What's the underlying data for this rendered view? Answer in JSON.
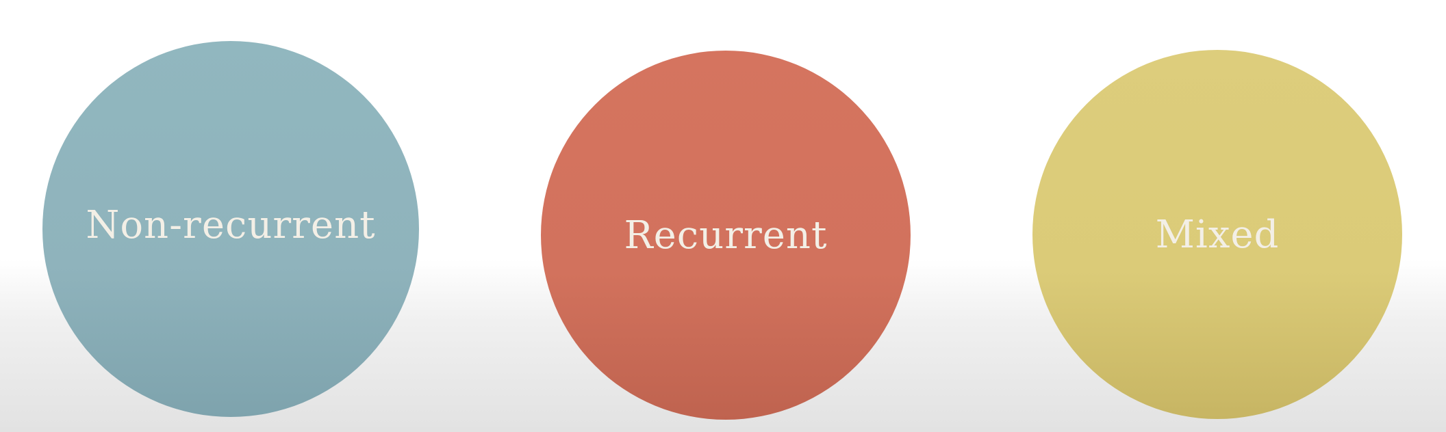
{
  "diagram": {
    "nodes": [
      {
        "label": "Non-recurrent",
        "color": "#91b7bf"
      },
      {
        "label": "Recurrent",
        "color": "#d5745f"
      },
      {
        "label": "Mixed",
        "color": "#ddcd7c"
      }
    ]
  }
}
